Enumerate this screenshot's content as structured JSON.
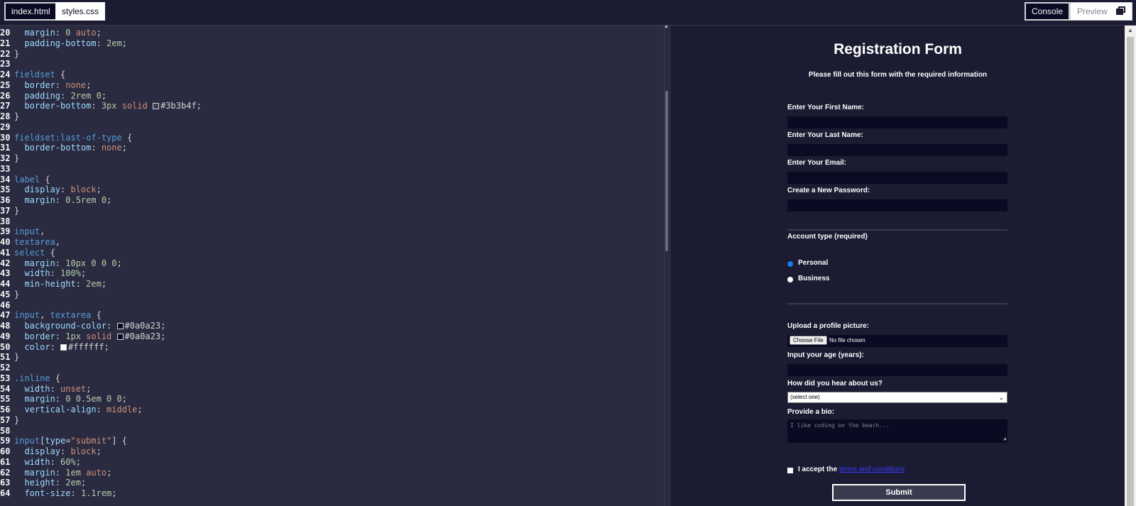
{
  "tabs": [
    {
      "label": "index.html"
    },
    {
      "label": "styles.css"
    }
  ],
  "toolbar": {
    "console_label": "Console",
    "preview_label": "Preview"
  },
  "editor": {
    "lines": [
      {
        "n": "20",
        "parts": [
          [
            "prop",
            "  margin"
          ],
          [
            "punc",
            ": "
          ],
          [
            "num",
            "0"
          ],
          [
            "val",
            " auto"
          ],
          [
            "punc",
            ";"
          ]
        ]
      },
      {
        "n": "21",
        "parts": [
          [
            "prop",
            "  padding-bottom"
          ],
          [
            "punc",
            ": "
          ],
          [
            "num",
            "2em"
          ],
          [
            "punc",
            ";"
          ]
        ]
      },
      {
        "n": "22",
        "parts": [
          [
            "punc",
            "}"
          ]
        ]
      },
      {
        "n": "23",
        "parts": []
      },
      {
        "n": "24",
        "parts": [
          [
            "sel",
            "fieldset"
          ],
          [
            "punc",
            " {"
          ]
        ]
      },
      {
        "n": "25",
        "parts": [
          [
            "prop",
            "  border"
          ],
          [
            "punc",
            ": "
          ],
          [
            "val",
            "none"
          ],
          [
            "punc",
            ";"
          ]
        ]
      },
      {
        "n": "26",
        "parts": [
          [
            "prop",
            "  padding"
          ],
          [
            "punc",
            ": "
          ],
          [
            "num",
            "2rem 0"
          ],
          [
            "punc",
            ";"
          ]
        ]
      },
      {
        "n": "27",
        "parts": [
          [
            "prop",
            "  border-bottom"
          ],
          [
            "punc",
            ": "
          ],
          [
            "num",
            "3px"
          ],
          [
            "val",
            " solid "
          ],
          [
            "swatch",
            "#3b3b4f"
          ],
          [
            "punc",
            "#3b3b4f;"
          ]
        ]
      },
      {
        "n": "28",
        "parts": [
          [
            "punc",
            "}"
          ]
        ]
      },
      {
        "n": "29",
        "parts": []
      },
      {
        "n": "30",
        "parts": [
          [
            "sel",
            "fieldset:last-of-type"
          ],
          [
            "punc",
            " {"
          ]
        ]
      },
      {
        "n": "31",
        "parts": [
          [
            "prop",
            "  border-bottom"
          ],
          [
            "punc",
            ": "
          ],
          [
            "val",
            "none"
          ],
          [
            "punc",
            ";"
          ]
        ]
      },
      {
        "n": "32",
        "parts": [
          [
            "punc",
            "}"
          ]
        ]
      },
      {
        "n": "33",
        "parts": []
      },
      {
        "n": "34",
        "parts": [
          [
            "sel",
            "label"
          ],
          [
            "punc",
            " {"
          ]
        ]
      },
      {
        "n": "35",
        "parts": [
          [
            "prop",
            "  display"
          ],
          [
            "punc",
            ": "
          ],
          [
            "val",
            "block"
          ],
          [
            "punc",
            ";"
          ]
        ]
      },
      {
        "n": "36",
        "parts": [
          [
            "prop",
            "  margin"
          ],
          [
            "punc",
            ": "
          ],
          [
            "num",
            "0.5rem 0"
          ],
          [
            "punc",
            ";"
          ]
        ]
      },
      {
        "n": "37",
        "parts": [
          [
            "punc",
            "}"
          ]
        ]
      },
      {
        "n": "38",
        "parts": []
      },
      {
        "n": "39",
        "parts": [
          [
            "sel",
            "input"
          ],
          [
            "punc",
            ","
          ]
        ]
      },
      {
        "n": "40",
        "parts": [
          [
            "sel",
            "textarea"
          ],
          [
            "punc",
            ","
          ]
        ]
      },
      {
        "n": "41",
        "parts": [
          [
            "sel",
            "select"
          ],
          [
            "punc",
            " {"
          ]
        ]
      },
      {
        "n": "42",
        "parts": [
          [
            "prop",
            "  margin"
          ],
          [
            "punc",
            ": "
          ],
          [
            "num",
            "10px 0 0 0"
          ],
          [
            "punc",
            ";"
          ]
        ]
      },
      {
        "n": "43",
        "parts": [
          [
            "prop",
            "  width"
          ],
          [
            "punc",
            ": "
          ],
          [
            "num",
            "100%"
          ],
          [
            "punc",
            ";"
          ]
        ]
      },
      {
        "n": "44",
        "parts": [
          [
            "prop",
            "  min-height"
          ],
          [
            "punc",
            ": "
          ],
          [
            "num",
            "2em"
          ],
          [
            "punc",
            ";"
          ]
        ]
      },
      {
        "n": "45",
        "parts": [
          [
            "punc",
            "}"
          ]
        ]
      },
      {
        "n": "46",
        "parts": []
      },
      {
        "n": "47",
        "parts": [
          [
            "sel",
            "input"
          ],
          [
            "punc",
            ", "
          ],
          [
            "sel",
            "textarea"
          ],
          [
            "punc",
            " {"
          ]
        ]
      },
      {
        "n": "48",
        "parts": [
          [
            "prop",
            "  background-color"
          ],
          [
            "punc",
            ": "
          ],
          [
            "swatch",
            "#0a0a23"
          ],
          [
            "punc",
            "#0a0a23;"
          ]
        ]
      },
      {
        "n": "49",
        "parts": [
          [
            "prop",
            "  border"
          ],
          [
            "punc",
            ": "
          ],
          [
            "num",
            "1px"
          ],
          [
            "val",
            " solid "
          ],
          [
            "swatch",
            "#0a0a23"
          ],
          [
            "punc",
            "#0a0a23;"
          ]
        ]
      },
      {
        "n": "50",
        "parts": [
          [
            "prop",
            "  color"
          ],
          [
            "punc",
            ": "
          ],
          [
            "swatch",
            "#ffffff"
          ],
          [
            "punc",
            "#ffffff;"
          ]
        ]
      },
      {
        "n": "51",
        "parts": [
          [
            "punc",
            "}"
          ]
        ]
      },
      {
        "n": "52",
        "parts": []
      },
      {
        "n": "53",
        "parts": [
          [
            "sel",
            ".inline"
          ],
          [
            "punc",
            " {"
          ]
        ]
      },
      {
        "n": "54",
        "parts": [
          [
            "prop",
            "  width"
          ],
          [
            "punc",
            ": "
          ],
          [
            "val",
            "unset"
          ],
          [
            "punc",
            ";"
          ]
        ]
      },
      {
        "n": "55",
        "parts": [
          [
            "prop",
            "  margin"
          ],
          [
            "punc",
            ": "
          ],
          [
            "num",
            "0 0.5em 0 0"
          ],
          [
            "punc",
            ";"
          ]
        ]
      },
      {
        "n": "56",
        "parts": [
          [
            "prop",
            "  vertical-align"
          ],
          [
            "punc",
            ": "
          ],
          [
            "val",
            "middle"
          ],
          [
            "punc",
            ";"
          ]
        ]
      },
      {
        "n": "57",
        "parts": [
          [
            "punc",
            "}"
          ]
        ]
      },
      {
        "n": "58",
        "parts": []
      },
      {
        "n": "59",
        "parts": [
          [
            "sel",
            "input"
          ],
          [
            "punc",
            "["
          ],
          [
            "prop",
            "type"
          ],
          [
            "punc",
            "="
          ],
          [
            "val",
            "\"submit\""
          ],
          [
            "punc",
            "] {"
          ]
        ]
      },
      {
        "n": "60",
        "parts": [
          [
            "prop",
            "  display"
          ],
          [
            "punc",
            ": "
          ],
          [
            "val",
            "block"
          ],
          [
            "punc",
            ";"
          ]
        ]
      },
      {
        "n": "61",
        "parts": [
          [
            "prop",
            "  width"
          ],
          [
            "punc",
            ": "
          ],
          [
            "num",
            "60%"
          ],
          [
            "punc",
            ";"
          ]
        ]
      },
      {
        "n": "62",
        "parts": [
          [
            "prop",
            "  margin"
          ],
          [
            "punc",
            ": "
          ],
          [
            "num",
            "1em"
          ],
          [
            "val",
            " auto"
          ],
          [
            "punc",
            ";"
          ]
        ]
      },
      {
        "n": "63",
        "parts": [
          [
            "prop",
            "  height"
          ],
          [
            "punc",
            ": "
          ],
          [
            "num",
            "2em"
          ],
          [
            "punc",
            ";"
          ]
        ]
      },
      {
        "n": "64",
        "parts": [
          [
            "prop",
            "  font-size"
          ],
          [
            "punc",
            ": "
          ],
          [
            "num",
            "1.1rem"
          ],
          [
            "punc",
            ";"
          ]
        ]
      }
    ]
  },
  "form": {
    "title": "Registration Form",
    "subtitle": "Please fill out this form with the required information",
    "first_name_label": "Enter Your First Name:",
    "last_name_label": "Enter Your Last Name:",
    "email_label": "Enter Your Email:",
    "password_label": "Create a New Password:",
    "account_type_label": "Account type (required)",
    "radio_personal": "Personal",
    "radio_business": "Business",
    "selected_account_type": "Personal",
    "upload_label": "Upload a profile picture:",
    "file_button": "Choose File",
    "file_status": "No file chosen",
    "age_label": "Input your age (years):",
    "referrer_label": "How did you hear about us?",
    "referrer_selected": "(select one)",
    "bio_label": "Provide a bio:",
    "bio_placeholder": "I like coding on the beach...",
    "terms_prefix": "I accept the ",
    "terms_link": "terms and conditions",
    "submit_label": "Submit"
  },
  "colors": {
    "accent_border": "#3b3b4f",
    "field_bg": "#0a0a23",
    "page_bg": "#1b1b32"
  }
}
